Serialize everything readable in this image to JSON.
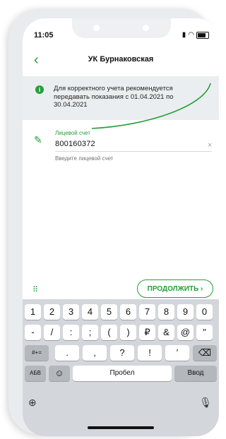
{
  "status_bar": {
    "time": "11:05"
  },
  "header": {
    "title": "УК Бурнаковская",
    "back_icon": "chevron-left-icon"
  },
  "info": {
    "text": "Для корректного учета рекомендуется передавать показания с 01.04.2021 по 30.04.2021"
  },
  "account": {
    "label": "Лицевой счет",
    "value": "800160372",
    "hint": "Введите лицевой счет",
    "clear": "×"
  },
  "actions": {
    "continue_label": "ПРОДОЛЖИТЬ ›"
  },
  "keyboard": {
    "row1": [
      "1",
      "2",
      "3",
      "4",
      "5",
      "6",
      "7",
      "8",
      "9",
      "0"
    ],
    "row2": [
      "-",
      "/",
      ":",
      ";",
      "(",
      ")",
      "₽",
      "&",
      "@",
      "\""
    ],
    "row3_left": "#+=",
    "row3": [
      ".",
      ",",
      "?",
      "!",
      "'"
    ],
    "row3_right": "⌫",
    "row4_left": "АБВ",
    "row4_emoji": "☺",
    "space": "Пробел",
    "enter": "Ввод"
  },
  "colors": {
    "accent": "#21a038",
    "info_bg": "#ebeef0",
    "keyboard_bg": "#d3d6da"
  }
}
